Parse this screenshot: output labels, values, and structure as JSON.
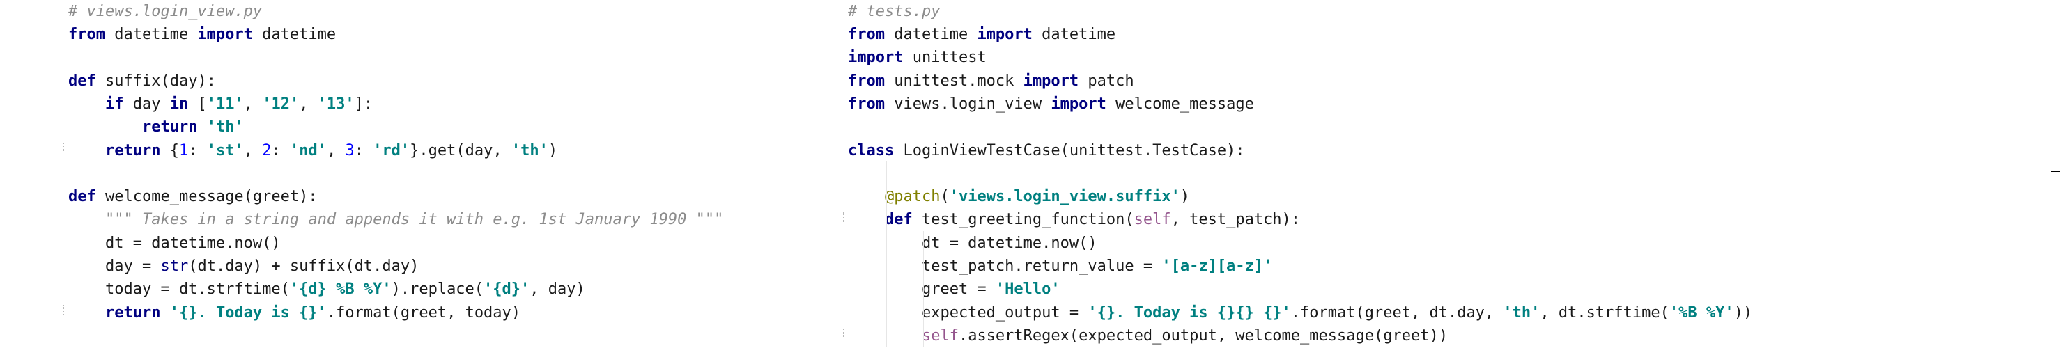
{
  "left_file": {
    "filename_comment": "# views.login_view.py",
    "lines": [
      [
        [
          "kw",
          "from"
        ],
        [
          "tx",
          " datetime "
        ],
        [
          "kw",
          "import"
        ],
        [
          "tx",
          " datetime"
        ]
      ],
      [],
      [
        [
          "kw",
          "def"
        ],
        [
          "tx",
          " suffix(day):"
        ]
      ],
      [
        [
          "tx",
          "    "
        ],
        [
          "kw",
          "if"
        ],
        [
          "tx",
          " day "
        ],
        [
          "kw",
          "in"
        ],
        [
          "tx",
          " ["
        ],
        [
          "st",
          "'11'"
        ],
        [
          "tx",
          ", "
        ],
        [
          "st",
          "'12'"
        ],
        [
          "tx",
          ", "
        ],
        [
          "st",
          "'13'"
        ],
        [
          "tx",
          "]:"
        ]
      ],
      [
        [
          "tx",
          "        "
        ],
        [
          "kw",
          "return"
        ],
        [
          "tx",
          " "
        ],
        [
          "st",
          "'th'"
        ]
      ],
      [
        [
          "tx",
          "    "
        ],
        [
          "kw",
          "return"
        ],
        [
          "tx",
          " {"
        ],
        [
          "nm",
          "1"
        ],
        [
          "tx",
          ": "
        ],
        [
          "st",
          "'st'"
        ],
        [
          "tx",
          ", "
        ],
        [
          "nm",
          "2"
        ],
        [
          "tx",
          ": "
        ],
        [
          "st",
          "'nd'"
        ],
        [
          "tx",
          ", "
        ],
        [
          "nm",
          "3"
        ],
        [
          "tx",
          ": "
        ],
        [
          "st",
          "'rd'"
        ],
        [
          "tx",
          "}.get(day, "
        ],
        [
          "st",
          "'th'"
        ],
        [
          "tx",
          ")"
        ]
      ],
      [],
      [
        [
          "kw",
          "def"
        ],
        [
          "tx",
          " welcome_message(greet):"
        ]
      ],
      [
        [
          "tx",
          "    "
        ],
        [
          "dc",
          "\"\"\" Takes in a string and appends it with e.g. 1st January 1990 \"\"\""
        ]
      ],
      [
        [
          "tx",
          "    dt = datetime.now()"
        ]
      ],
      [
        [
          "tx",
          "    day = "
        ],
        [
          "bi",
          "str"
        ],
        [
          "tx",
          "(dt.day) + suffix(dt.day)"
        ]
      ],
      [
        [
          "tx",
          "    today = dt.strftime("
        ],
        [
          "st",
          "'{d} %B %Y'"
        ],
        [
          "tx",
          ").replace("
        ],
        [
          "st",
          "'{d}'"
        ],
        [
          "tx",
          ", day)"
        ]
      ],
      [
        [
          "tx",
          "    "
        ],
        [
          "kw",
          "return"
        ],
        [
          "tx",
          " "
        ],
        [
          "st",
          "'{}. Today is {}'"
        ],
        [
          "tx",
          ".format(greet, today)"
        ]
      ]
    ]
  },
  "right_file": {
    "filename_comment": "# tests.py",
    "lines": [
      [
        [
          "kw",
          "from"
        ],
        [
          "tx",
          " datetime "
        ],
        [
          "kw",
          "import"
        ],
        [
          "tx",
          " datetime"
        ]
      ],
      [
        [
          "kw",
          "import"
        ],
        [
          "tx",
          " unittest"
        ]
      ],
      [
        [
          "kw",
          "from"
        ],
        [
          "tx",
          " unittest.mock "
        ],
        [
          "kw",
          "import"
        ],
        [
          "tx",
          " patch"
        ]
      ],
      [
        [
          "kw",
          "from"
        ],
        [
          "tx",
          " views.login_view "
        ],
        [
          "kw",
          "import"
        ],
        [
          "tx",
          " welcome_message"
        ]
      ],
      [],
      [
        [
          "kw",
          "class"
        ],
        [
          "tx",
          " LoginViewTestCase(unittest.TestCase):"
        ]
      ],
      [],
      [
        [
          "tx",
          "    "
        ],
        [
          "dec",
          "@patch"
        ],
        [
          "tx",
          "("
        ],
        [
          "st",
          "'views.login_view.suffix'"
        ],
        [
          "tx",
          ")"
        ]
      ],
      [
        [
          "tx",
          "    "
        ],
        [
          "kw",
          "def"
        ],
        [
          "tx",
          " test_greeting_function("
        ],
        [
          "sf",
          "self"
        ],
        [
          "tx",
          ", test_patch):"
        ]
      ],
      [
        [
          "tx",
          "        dt = datetime.now()"
        ]
      ],
      [
        [
          "tx",
          "        test_patch.return_value = "
        ],
        [
          "st",
          "'[a-z][a-z]'"
        ]
      ],
      [
        [
          "tx",
          "        greet = "
        ],
        [
          "st",
          "'Hello'"
        ]
      ],
      [
        [
          "tx",
          "        expected_output = "
        ],
        [
          "st",
          "'{}. Today is {}{} {}'"
        ],
        [
          "tx",
          ".format(greet, dt.day, "
        ],
        [
          "st",
          "'th'"
        ],
        [
          "tx",
          ", dt.strftime("
        ],
        [
          "st",
          "'%B %Y'"
        ],
        [
          "tx",
          "))"
        ]
      ],
      [
        [
          "tx",
          "        "
        ],
        [
          "sf",
          "self"
        ],
        [
          "tx",
          ".assertRegex(expected_output, welcome_message(greet))"
        ]
      ]
    ]
  }
}
